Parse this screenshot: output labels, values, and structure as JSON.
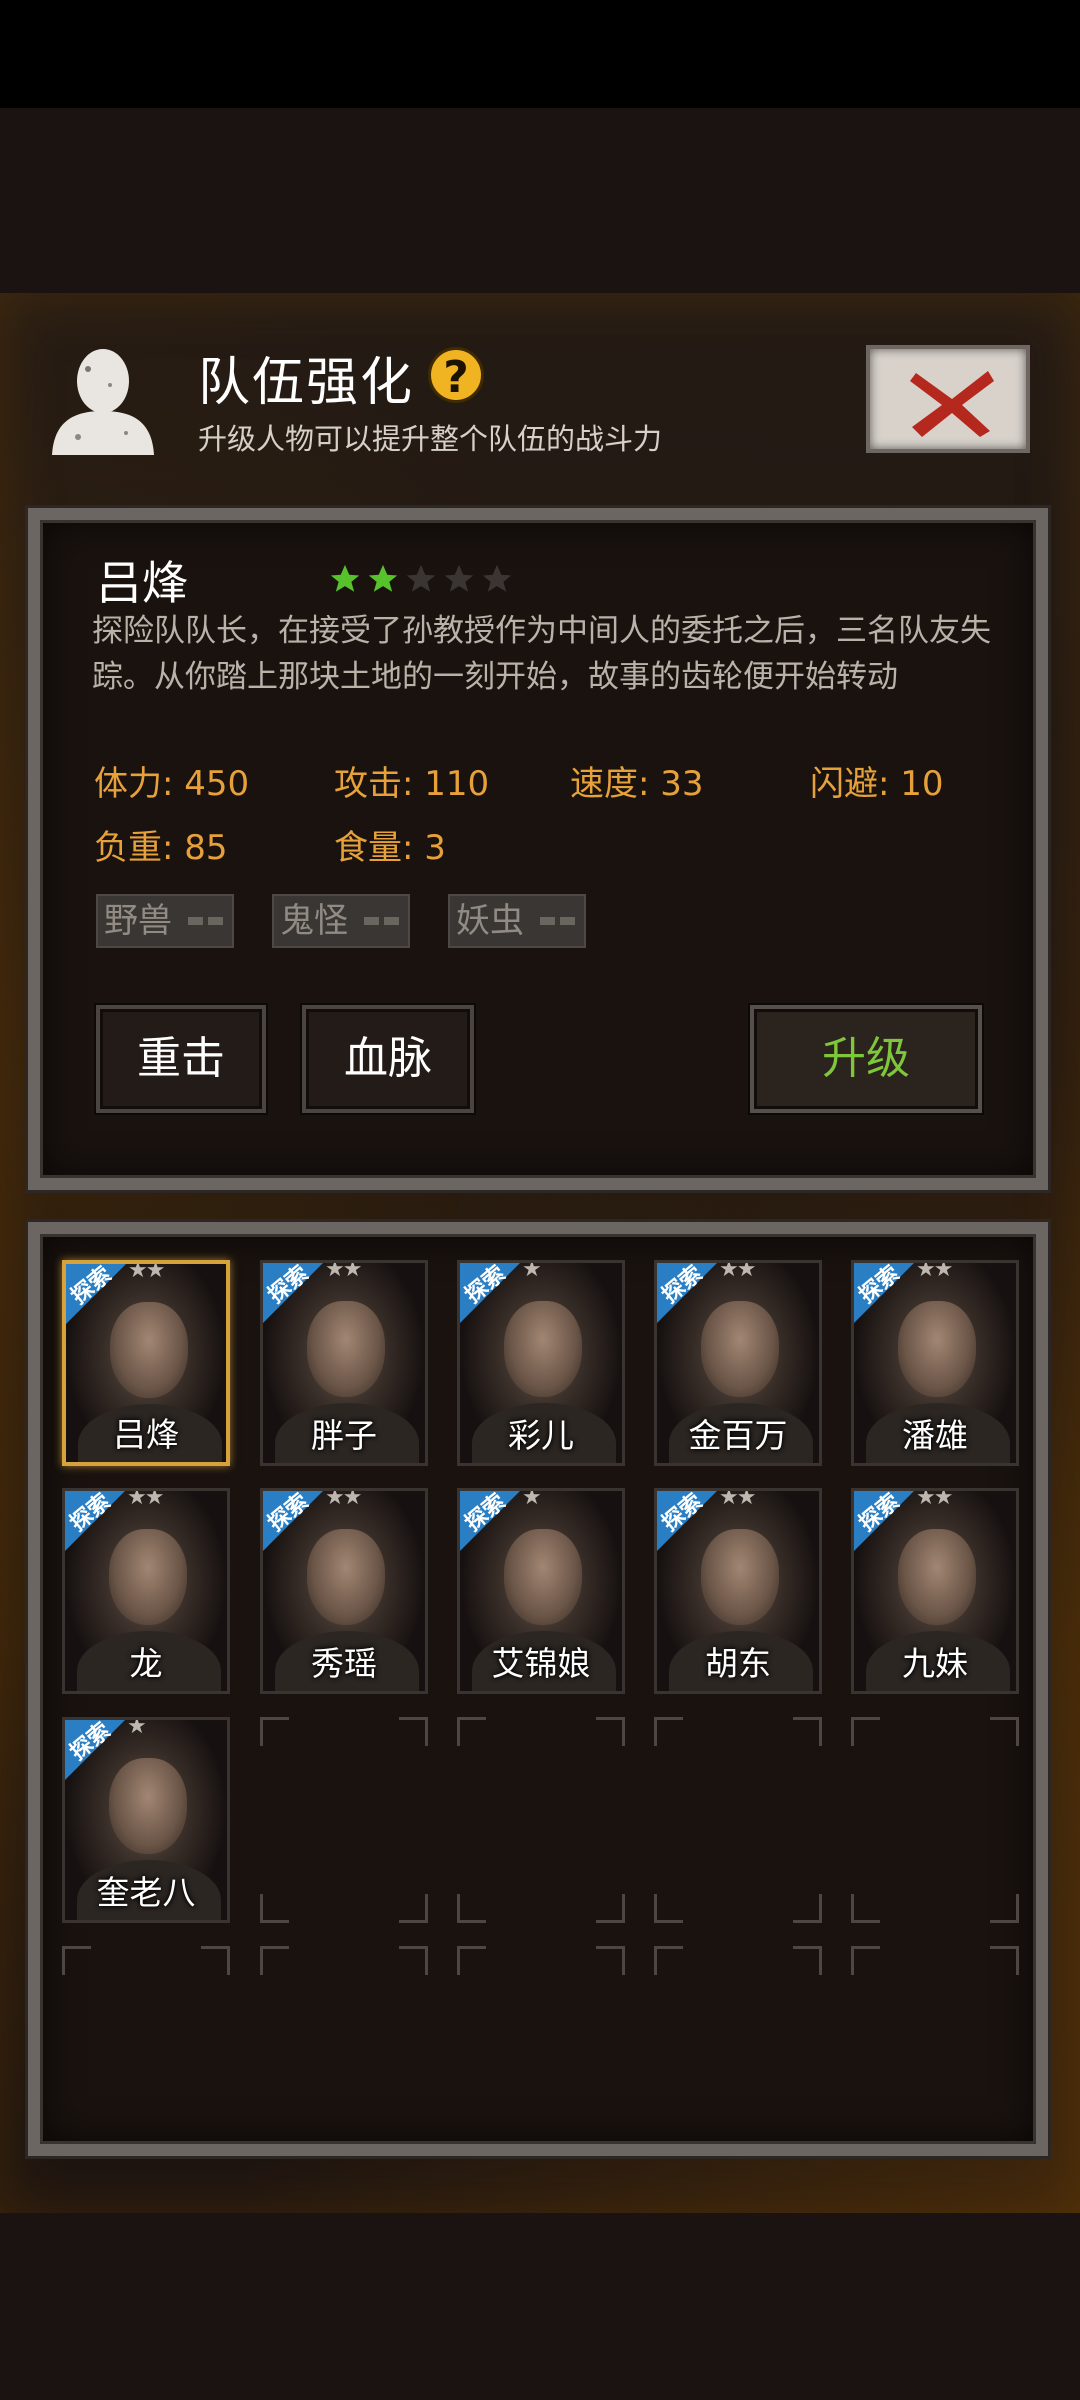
{
  "header": {
    "title": "队伍强化",
    "help_symbol": "?",
    "subtitle": "升级人物可以提升整个队伍的战斗力",
    "close_icon": "close-x-icon"
  },
  "character": {
    "name": "吕烽",
    "stars_filled": 2,
    "stars_total": 5,
    "description": "探险队队长，在接受了孙教授作为中间人的委托之后，三名队友失踪。从你踏上那块土地的一刻开始，故事的齿轮便开始转动",
    "stats": {
      "hp": "体力: 450",
      "attack": "攻击: 110",
      "speed": "速度: 33",
      "dodge": "闪避: 10",
      "load": "负重: 85",
      "food": "食量: 3"
    },
    "tags": [
      "野兽",
      "鬼怪",
      "妖虫"
    ]
  },
  "buttons": {
    "heavy_strike": "重击",
    "bloodline": "血脉",
    "upgrade": "升级"
  },
  "roster": {
    "badge_label": "探索",
    "members": [
      {
        "name": "吕烽",
        "stars": "★★"
      },
      {
        "name": "胖子",
        "stars": "★★"
      },
      {
        "name": "彩儿",
        "stars": "★"
      },
      {
        "name": "金百万",
        "stars": "★★"
      },
      {
        "name": "潘雄",
        "stars": "★★"
      },
      {
        "name": "龙",
        "stars": "★★"
      },
      {
        "name": "秀瑶",
        "stars": "★★"
      },
      {
        "name": "艾锦娘",
        "stars": "★"
      },
      {
        "name": "胡东",
        "stars": "★★"
      },
      {
        "name": "九妹",
        "stars": "★★"
      },
      {
        "name": "奎老八",
        "stars": "★"
      }
    ]
  },
  "colors": {
    "accent_orange": "#e7a13a",
    "upgrade_green": "#7ec63a",
    "star_green": "#57c22b",
    "badge_blue": "#2a7fc4",
    "selected_gold": "#d6a23b"
  }
}
